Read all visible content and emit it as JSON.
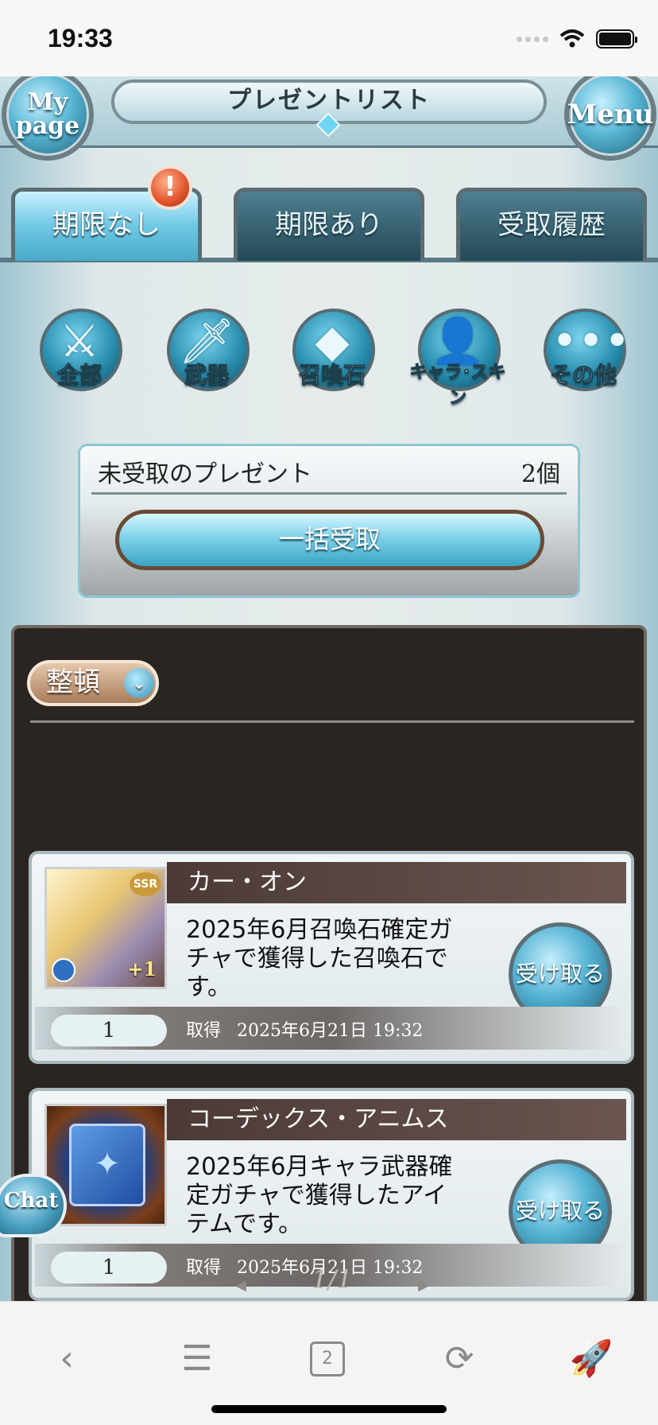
{
  "status_bar": {
    "time": "19:33"
  },
  "header": {
    "title": "プレゼントリスト",
    "mypage_label_1": "My",
    "mypage_label_2": "page",
    "menu_label": "Menu"
  },
  "tabs": [
    {
      "label": "期限なし",
      "active": true
    },
    {
      "label": "期限あり",
      "active": false
    },
    {
      "label": "受取履歴",
      "active": false
    }
  ],
  "alert_badge": "!",
  "categories": [
    {
      "label": "全部"
    },
    {
      "label": "武器"
    },
    {
      "label": "召喚石"
    },
    {
      "label": "キャラ･スキン"
    },
    {
      "label": "その他"
    }
  ],
  "unreceived": {
    "label": "未受取のプレゼント",
    "count": "2個",
    "bulk_button": "一括受取"
  },
  "sort": {
    "label": "整頓"
  },
  "items": [
    {
      "name": "カー・オン",
      "description": "2025年6月召喚石確定ガチャで獲得した召喚石です。",
      "quantity": "1",
      "acquired_label": "取得",
      "acquired_date": "2025年6月21日 19:32",
      "receive_button": "受け取る",
      "rarity_tag": "SSR",
      "plus_tag": "+1"
    },
    {
      "name": "コーデックス・アニムス",
      "description": "2025年6月キャラ武器確定ガチャで獲得したアイテムです。",
      "quantity": "1",
      "acquired_label": "取得",
      "acquired_date": "2025年6月21日 19:32",
      "receive_button": "受け取る"
    }
  ],
  "pager": {
    "text": "1/1"
  },
  "chat": {
    "label": "Chat"
  },
  "browser_bar": {
    "tab_count": "2",
    "icons": [
      "back-icon",
      "menu-icon",
      "tabs-icon",
      "reload-icon",
      "rocket-icon"
    ]
  }
}
